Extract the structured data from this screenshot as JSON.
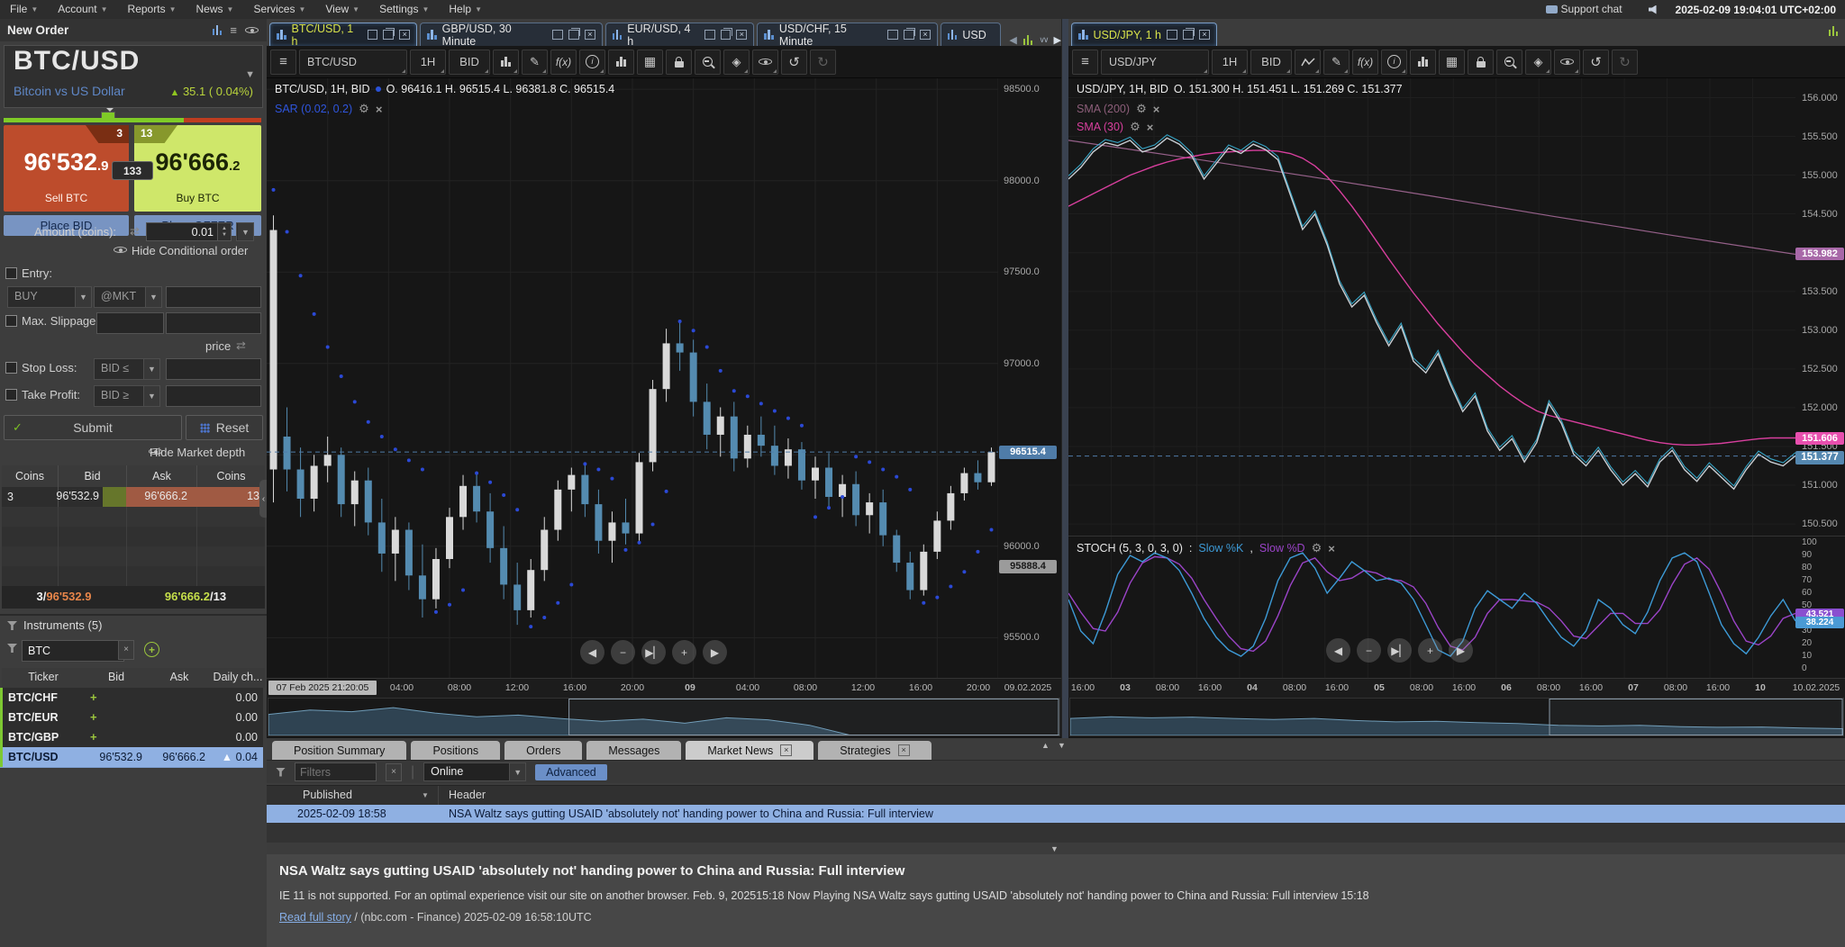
{
  "menu_bar": {
    "items": [
      "File",
      "Account",
      "Reports",
      "News",
      "Services",
      "View",
      "Settings",
      "Help"
    ],
    "support_chat": "Support chat",
    "clock": "2025-02-09 19:04:01 UTC+02:00"
  },
  "new_order": {
    "title": "New Order",
    "symbol": "BTC/USD",
    "symbol_desc": "Bitcoin vs US Dollar",
    "change_arrow": "▲",
    "change": "35.1 ( 0.04%)",
    "sell_depth": "3",
    "sell_price_main": "96'532",
    "sell_price_dec": ".9",
    "sell_label": "Sell BTC",
    "buy_depth": "13",
    "buy_price_main": "96'666",
    "buy_price_dec": ".2",
    "buy_label": "Buy BTC",
    "spread": "133",
    "place_bid": "Place BID",
    "place_offer": "Place OFFER",
    "amount_label": "Amount (coins):",
    "amount_value": "0.01",
    "hide_conditional": "Hide Conditional order",
    "entry_label": "Entry:",
    "entry_side": "BUY",
    "entry_type": "@MKT",
    "max_slippage_label": "Max. Slippage:",
    "price_label": "price",
    "stop_loss_label": "Stop Loss:",
    "stop_loss_cond": "BID ≤",
    "take_profit_label": "Take Profit:",
    "take_profit_cond": "BID ≥",
    "submit_label": "Submit",
    "reset_label": "Reset",
    "hide_market_depth": "Hide Market depth",
    "depth_headers": [
      "Coins",
      "Bid",
      "Ask",
      "Coins"
    ],
    "depth_row": [
      "3",
      "96'532.9",
      "96'666.2",
      "13"
    ],
    "depth_footer": {
      "bid_qty": "3/",
      "bid_price": "96'532.9",
      "ask_price": "96'666.2",
      "ask_qty": "/13"
    }
  },
  "instruments": {
    "title": "Instruments (5)",
    "filter_value": "BTC",
    "headers": [
      "Ticker",
      "Bid",
      "Ask",
      "Daily ch..."
    ],
    "rows": [
      {
        "ticker": "BTC/CHF",
        "bid": "+",
        "ask": "",
        "change": "0.00",
        "selected": false
      },
      {
        "ticker": "BTC/EUR",
        "bid": "+",
        "ask": "",
        "change": "0.00",
        "selected": false
      },
      {
        "ticker": "BTC/GBP",
        "bid": "+",
        "ask": "",
        "change": "0.00",
        "selected": false
      },
      {
        "ticker": "BTC/USD",
        "bid": "96'532.9",
        "ask": "96'666.2",
        "change": "0.04",
        "selected": true
      }
    ]
  },
  "chart_tabs": [
    {
      "label": "BTC/USD, 1 h",
      "active": true,
      "truncated": false
    },
    {
      "label": "GBP/USD, 30 Minute",
      "active": false,
      "truncated": false
    },
    {
      "label": "EUR/USD, 4 h",
      "active": false,
      "truncated": false
    },
    {
      "label": "USD/CHF, 15 Minute",
      "active": false,
      "truncated": false
    },
    {
      "label": "USD",
      "active": false,
      "truncated": true
    }
  ],
  "jpy_tab": {
    "label": "USD/JPY, 1 h",
    "active": true
  },
  "btc_toolbar": {
    "symbol": "BTC/USD",
    "timeframe": "1H",
    "price_type": "BID",
    "fx": "f(x)"
  },
  "jpy_toolbar": {
    "symbol": "USD/JPY",
    "timeframe": "1H",
    "price_type": "BID",
    "fx": "f(x)"
  },
  "chart_data": [
    {
      "type": "candlestick",
      "title": "BTC/USD, 1H, BID",
      "ohlc_label": "BTC/USD, 1H, BID",
      "ohlc_values": "O. 96416.1 H. 96515.4 L. 96381.8 C. 96515.4",
      "indicator_label": "SAR (0.02, 0.2)",
      "ylim": [
        95280,
        98560
      ],
      "y_ticks": [
        "98500.0",
        "98000.0",
        "97500.0",
        "97000.0",
        "96500.0",
        "96000.0",
        "95500.0"
      ],
      "current_price": 96515.4,
      "current_price_label": "96515.4",
      "low_marker": 95888.4,
      "low_marker_label": "95888.4",
      "time_cursor_label": "07 Feb 2025 21:20:05",
      "time_labels": [
        "04:00",
        "08:00",
        "12:00",
        "16:00",
        "20:00",
        "09",
        "04:00",
        "08:00",
        "12:00",
        "16:00",
        "20:00"
      ],
      "date_label": "09.02.2025",
      "candles": [
        [
          96420,
          97810,
          96240,
          97730
        ],
        [
          96600,
          96760,
          96300,
          96420
        ],
        [
          96420,
          96540,
          96160,
          96260
        ],
        [
          96260,
          96500,
          96190,
          96440
        ],
        [
          96440,
          96600,
          96350,
          96500
        ],
        [
          96500,
          96540,
          96160,
          96230
        ],
        [
          96230,
          96410,
          96110,
          96360
        ],
        [
          96360,
          96430,
          96060,
          96130
        ],
        [
          96130,
          96260,
          95860,
          95960
        ],
        [
          95960,
          96160,
          95810,
          96090
        ],
        [
          96090,
          96130,
          95760,
          95840
        ],
        [
          95840,
          96010,
          95610,
          95710
        ],
        [
          95710,
          95990,
          95660,
          95930
        ],
        [
          95930,
          96210,
          95880,
          96160
        ],
        [
          96160,
          96390,
          96090,
          96330
        ],
        [
          96330,
          96410,
          96130,
          96190
        ],
        [
          96190,
          96290,
          95910,
          95990
        ],
        [
          95990,
          96110,
          95710,
          95790
        ],
        [
          95790,
          95910,
          95570,
          95650
        ],
        [
          95650,
          95930,
          95610,
          95870
        ],
        [
          95870,
          96160,
          95810,
          96090
        ],
        [
          96090,
          96360,
          96030,
          96310
        ],
        [
          96310,
          96430,
          96190,
          96390
        ],
        [
          96390,
          96460,
          96160,
          96230
        ],
        [
          96230,
          96310,
          95960,
          96030
        ],
        [
          96030,
          96190,
          95910,
          96130
        ],
        [
          96130,
          96260,
          96010,
          96070
        ],
        [
          96070,
          96510,
          96030,
          96460
        ],
        [
          96460,
          96910,
          96410,
          96860
        ],
        [
          96860,
          97190,
          96790,
          97110
        ],
        [
          97110,
          97230,
          96960,
          97060
        ],
        [
          97060,
          97130,
          96710,
          96790
        ],
        [
          96790,
          96890,
          96530,
          96610
        ],
        [
          96610,
          96760,
          96490,
          96710
        ],
        [
          96710,
          96790,
          96410,
          96480
        ],
        [
          96480,
          96660,
          96430,
          96610
        ],
        [
          96610,
          96710,
          96490,
          96550
        ],
        [
          96550,
          96660,
          96390,
          96440
        ],
        [
          96440,
          96590,
          96370,
          96530
        ],
        [
          96530,
          96570,
          96310,
          96360
        ],
        [
          96360,
          96490,
          96260,
          96430
        ],
        [
          96430,
          96510,
          96210,
          96270
        ],
        [
          96270,
          96390,
          96160,
          96340
        ],
        [
          96340,
          96410,
          96110,
          96170
        ],
        [
          96170,
          96290,
          96070,
          96240
        ],
        [
          96240,
          96310,
          96000,
          96060
        ],
        [
          96060,
          96090,
          95860,
          95910
        ],
        [
          95910,
          95970,
          95710,
          95760
        ],
        [
          95760,
          96010,
          95730,
          95970
        ],
        [
          95970,
          96190,
          95930,
          96140
        ],
        [
          96140,
          96330,
          96090,
          96290
        ],
        [
          96290,
          96430,
          96250,
          96400
        ],
        [
          96400,
          96470,
          96310,
          96350
        ],
        [
          96350,
          96540,
          96330,
          96515
        ]
      ],
      "sar": [
        97950,
        97720,
        97480,
        97270,
        97090,
        96930,
        96790,
        96680,
        96600,
        96530,
        96470,
        96420,
        95640,
        95680,
        95760,
        96400,
        96350,
        96280,
        96200,
        95560,
        95610,
        95690,
        95790,
        96450,
        96420,
        96370,
        95980,
        96020,
        96120,
        96300,
        97230,
        97180,
        97090,
        96960,
        96850,
        96820,
        96780,
        96740,
        96700,
        96660,
        96160,
        96210,
        96270,
        96490,
        96460,
        96420,
        96380,
        96310,
        95690,
        95720,
        95780,
        95860,
        95970,
        96090
      ],
      "navigator": {
        "heights": [
          0.62,
          0.75,
          0.7,
          0.82,
          0.66,
          0.55,
          0.6,
          0.5,
          0.42,
          0.48,
          0.36,
          0.52,
          0.46,
          0.3,
          0,
          0,
          0,
          0,
          0,
          0
        ],
        "sel_start": 0.38
      }
    },
    {
      "type": "line",
      "title": "USD/JPY, 1H, BID",
      "ohlc_label": "USD/JPY, 1H, BID",
      "ohlc_values": "O. 151.300 H. 151.451 L. 151.269 C. 151.377",
      "sma200_label": "SMA (200)",
      "sma30_label": "SMA (30)",
      "ylim": [
        150.35,
        156.25
      ],
      "y_ticks": [
        "156.000",
        "155.500",
        "155.000",
        "154.500",
        "154.000",
        "153.500",
        "153.000",
        "152.500",
        "152.000",
        "151.500",
        "151.000",
        "150.500"
      ],
      "series": [
        {
          "name": "price",
          "values": [
            154.95,
            155.1,
            155.3,
            155.42,
            155.38,
            155.45,
            155.3,
            155.35,
            155.48,
            155.4,
            155.25,
            154.95,
            155.15,
            155.35,
            155.28,
            155.4,
            155.33,
            155.2,
            154.75,
            154.3,
            154.5,
            154.1,
            153.6,
            153.3,
            153.45,
            153.1,
            152.8,
            153.05,
            152.6,
            152.45,
            152.7,
            152.3,
            151.95,
            152.15,
            151.7,
            151.45,
            151.6,
            151.3,
            151.55,
            152.05,
            151.8,
            151.4,
            151.25,
            151.45,
            151.2,
            151.0,
            151.15,
            150.98,
            151.3,
            151.45,
            151.2,
            151.05,
            151.25,
            151.1,
            150.95,
            151.2,
            151.4,
            151.3,
            151.25,
            151.38
          ]
        },
        {
          "name": "sma30",
          "values": [
            154.6,
            154.68,
            154.76,
            154.84,
            154.92,
            155.0,
            155.06,
            155.12,
            155.17,
            155.21,
            155.24,
            155.27,
            155.29,
            155.3,
            155.31,
            155.32,
            155.32,
            155.31,
            155.28,
            155.22,
            155.12,
            154.98,
            154.8,
            154.6,
            154.38,
            154.15,
            153.92,
            153.7,
            153.48,
            153.28,
            153.08,
            152.9,
            152.72,
            152.56,
            152.42,
            152.28,
            152.16,
            152.05,
            151.96,
            151.9,
            151.86,
            151.82,
            151.78,
            151.74,
            151.7,
            151.66,
            151.62,
            151.58,
            151.55,
            151.53,
            151.52,
            151.52,
            151.53,
            151.54,
            151.56,
            151.58,
            151.6,
            151.61,
            151.61,
            151.61
          ]
        },
        {
          "name": "sma200",
          "values": [
            155.45,
            155.22,
            154.98,
            154.73,
            154.47,
            154.22,
            153.98
          ]
        }
      ],
      "markers": {
        "sma200": 153.982,
        "sma200_label": "153.982",
        "sma30": 151.606,
        "sma30_label": "151.606",
        "price": 151.377,
        "price_label": "151.377"
      },
      "time_labels": [
        "16:00",
        "03",
        "08:00",
        "16:00",
        "04",
        "08:00",
        "16:00",
        "05",
        "08:00",
        "16:00",
        "06",
        "08:00",
        "16:00",
        "07",
        "08:00",
        "16:00",
        "10"
      ],
      "date_label": "10.02.2025",
      "navigator": {
        "heights": [
          0.5,
          0.55,
          0.52,
          0.54,
          0.5,
          0.47,
          0.5,
          0.44,
          0.4,
          0.42,
          0.38,
          0.35,
          0.3,
          0.28,
          0.3,
          0.26,
          0.24,
          0.25,
          0.22,
          0.2
        ],
        "sel_start": 0.62
      }
    },
    {
      "type": "line",
      "title": "STOCH (5, 3, 0, 3, 0)",
      "k_label": "Slow %K",
      "d_label": "Slow %D",
      "sep": " : ",
      "ylim": [
        0,
        100
      ],
      "y_ticks": [
        "100",
        "90",
        "80",
        "70",
        "60",
        "50",
        "40",
        "30",
        "20",
        "10",
        "0"
      ],
      "series": [
        {
          "name": "Slow %K",
          "values": [
            55,
            30,
            20,
            45,
            75,
            90,
            85,
            92,
            88,
            78,
            60,
            40,
            25,
            15,
            10,
            18,
            40,
            70,
            88,
            92,
            80,
            60,
            72,
            85,
            78,
            70,
            72,
            68,
            55,
            35,
            15,
            10,
            22,
            48,
            62,
            55,
            48,
            60,
            52,
            38,
            25,
            18,
            30,
            55,
            48,
            35,
            28,
            45,
            70,
            88,
            92,
            85,
            60,
            35,
            20,
            12,
            25,
            42,
            55,
            38
          ]
        },
        {
          "name": "Slow %D",
          "values": [
            60,
            45,
            32,
            30,
            45,
            68,
            84,
            89,
            88,
            83,
            72,
            55,
            40,
            26,
            16,
            14,
            22,
            42,
            66,
            84,
            88,
            77,
            70,
            72,
            78,
            76,
            71,
            70,
            65,
            52,
            33,
            18,
            15,
            25,
            44,
            55,
            55,
            54,
            53,
            48,
            38,
            26,
            24,
            34,
            44,
            44,
            36,
            36,
            47,
            67,
            83,
            88,
            79,
            60,
            38,
            22,
            19,
            26,
            40,
            44
          ]
        }
      ],
      "markers": {
        "k": 38.224,
        "k_label": "38.224",
        "d": 43.521,
        "d_label": "43.521"
      }
    }
  ],
  "bottom_panel": {
    "tabs": [
      {
        "label": "Position Summary",
        "closable": false,
        "active": false
      },
      {
        "label": "Positions",
        "closable": false,
        "active": false
      },
      {
        "label": "Orders",
        "closable": false,
        "active": false
      },
      {
        "label": "Messages",
        "closable": false,
        "active": false
      },
      {
        "label": "Market News",
        "closable": true,
        "active": true
      },
      {
        "label": "Strategies",
        "closable": true,
        "active": false
      }
    ],
    "filters_placeholder": "Filters",
    "online_value": "Online",
    "advanced_label": "Advanced",
    "news_headers": [
      "Published",
      "Header"
    ],
    "news_row": {
      "published": "2025-02-09 18:58",
      "header": "NSA Waltz says gutting USAID 'absolutely not' handing power to China and Russia: Full interview"
    },
    "article": {
      "title": "NSA Waltz says gutting USAID 'absolutely not' handing power to China and Russia: Full interview",
      "body": "IE 11 is not supported. For an optimal experience visit our site on another browser. Feb. 9, 202515:18 Now Playing NSA Waltz says gutting USAID 'absolutely not' handing power to China and Russia: Full interview 15:18",
      "link": "Read full story",
      "source": " / (nbc.com - Finance) 2025-02-09 16:58:10UTC"
    }
  }
}
